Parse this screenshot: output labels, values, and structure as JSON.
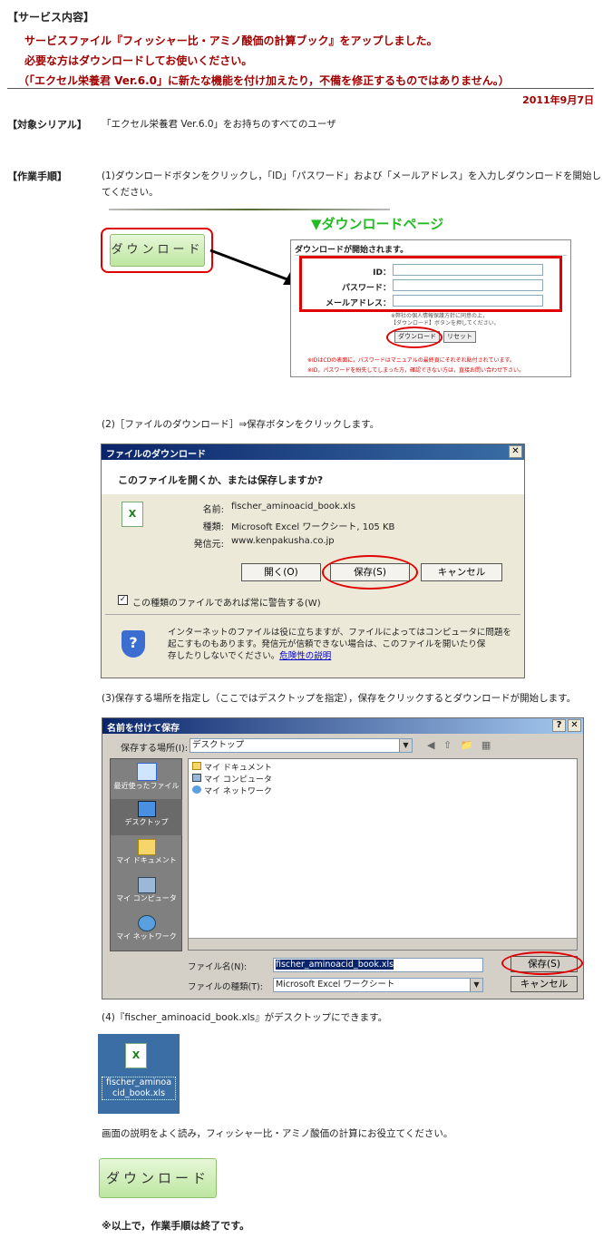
{
  "service": {
    "heading": "【サービス内容】",
    "line1": "サービスファイル『フィッシャー比・アミノ酸価の計算ブック』をアップしました。",
    "line2": "必要な方はダウンロードしてお使いください。",
    "line3": "（「エクセル栄養君 Ver.6.0」に新たな機能を付け加えたり，不備を修正するものではありません。）",
    "date": "2011年9月7日"
  },
  "target": {
    "label": "【対象シリアル】",
    "text": "「エクセル栄養君 Ver.6.0」をお持ちのすべてのユーザ"
  },
  "steps": {
    "label": "【作業手順】",
    "step1_a": "(1)ダウンロードボタンをクリックし，「ID」「パスワード」および「メールアドレス」を入力しダウンロードを開始し",
    "step1_b": "てください。",
    "download_btn": "ダウンロード",
    "page_title": "▼ダウンロードページ",
    "dl_form": {
      "header": "ダウンロードが開始されます。",
      "id_label": "ID：",
      "pw_label": "パスワード：",
      "mail_label": "メールアドレス：",
      "note1": "※弊社の個人情報保護方針に同意の上，",
      "note2": "【ダウンロード】ボタンを押してください。",
      "download": "ダウンロード",
      "reset": "リセット",
      "warn1": "※IDはCDの表面に，パスワードはマニュアルの最終頁にそれぞれ貼付されています。",
      "warn2": "※ID，パスワードを紛失してしまった方，確認できない方は，直接お問い合わせ下さい。"
    },
    "step2": "(2)［ファイルのダウンロード］⇒保存ボタンをクリックします。",
    "dialog1": {
      "title": "ファイルのダウンロード",
      "question": "このファイルを開くか、または保存しますか?",
      "name_label": "名前:",
      "name_value": "fischer_aminoacid_book.xls",
      "type_label": "種類:",
      "type_value": "Microsoft Excel ワークシート, 105 KB",
      "from_label": "発信元:",
      "from_value": "www.kenpakusha.co.jp",
      "open": "開く(O)",
      "save": "保存(S)",
      "cancel": "キャンセル",
      "checkbox": "この種類のファイルであれば常に警告する(W)",
      "warning1": "インターネットのファイルは役に立ちますが、ファイルによってはコンピュータに問題を",
      "warning2": "起こすものもあります。発信元が信頼できない場合は、このファイルを開いたり保",
      "warning3": "存したりしないでください。",
      "risk_link": "危険性の説明"
    },
    "step3": "(3)保存する場所を指定し（ここではデスクトップを指定），保存をクリックするとダウンロードが開始します。",
    "dialog2": {
      "title": "名前を付けて保存",
      "location_label": "保存する場所(I):",
      "location_value": "デスクトップ",
      "places": [
        "最近使ったファイル",
        "デスクトップ",
        "マイ ドキュメント",
        "マイ コンピュータ",
        "マイ ネットワーク"
      ],
      "files": [
        "マイ ドキュメント",
        "マイ コンピュータ",
        "マイ ネットワーク"
      ],
      "filename_label": "ファイル名(N):",
      "filename_value": "fischer_aminoacid_book.xls",
      "filetype_label": "ファイルの種類(T):",
      "filetype_value": "Microsoft Excel ワークシート",
      "save": "保存(S)",
      "cancel": "キャンセル"
    },
    "step4": "(4)『fischer_aminoacid_book.xls』がデスクトップにできます。",
    "desktop_file1": "fischer_aminoa",
    "desktop_file2": "cid_book.xls",
    "closing": "画面の説明をよく読み，フィッシャー比・アミノ酸価の計算にお役立てください。",
    "download_btn2": "ダウンロード",
    "end": "※以上で，作業手順は終了です。"
  },
  "colors": {
    "accent_red": "#a00000",
    "dl_green": "#22bb22",
    "ring_red": "#e00000"
  }
}
